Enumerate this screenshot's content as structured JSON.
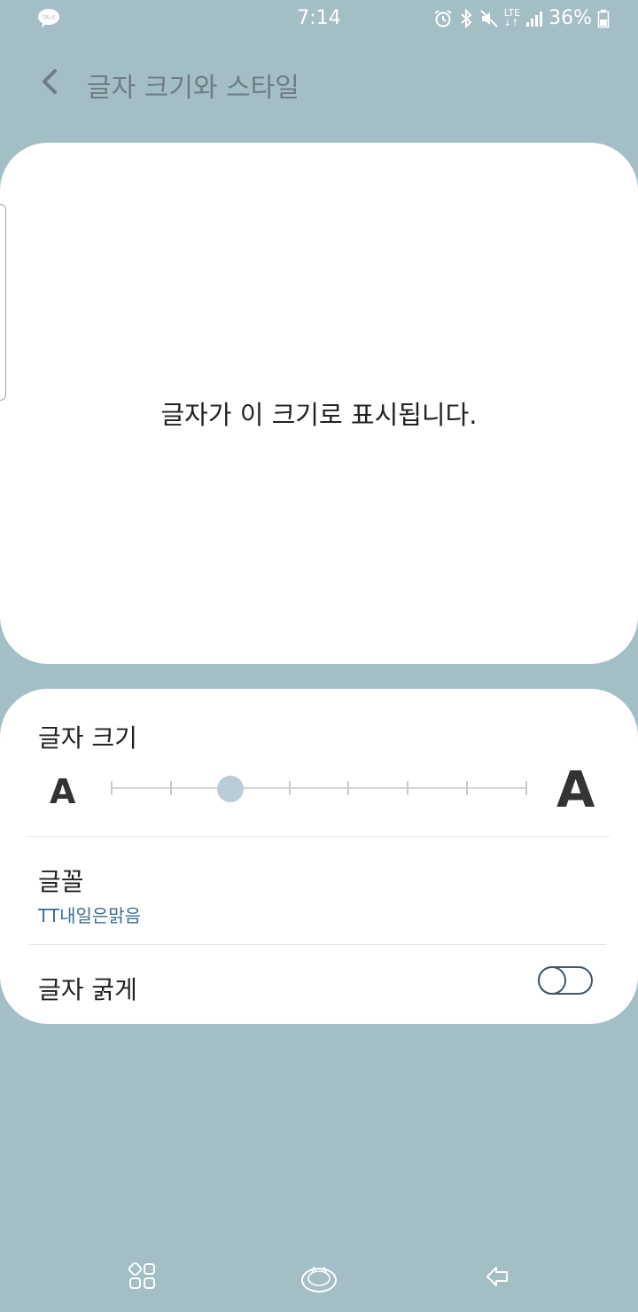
{
  "status_bar": {
    "time": "7:14",
    "talk_badge": "TALK",
    "network": "LTE",
    "battery": "36%",
    "icons": [
      "kakaotalk-icon",
      "alarm-icon",
      "bluetooth-icon",
      "mute-icon",
      "lte-icon",
      "signal-icon",
      "battery-icon"
    ]
  },
  "appbar": {
    "title": "글자 크기와 스타일"
  },
  "preview": {
    "text": "글자가 이 크기로 표시됩니다."
  },
  "font_size": {
    "label": "글자 크기",
    "small_glyph": "A",
    "large_glyph": "A",
    "steps": 8,
    "selected_step": 3
  },
  "font": {
    "label": "글꼴",
    "value": "TT내일은맑음"
  },
  "bold_text": {
    "label": "글자 굵게",
    "enabled": false
  },
  "colors": {
    "background": "#a4bec6",
    "accent_blue": "#3b6e92",
    "thumb": "#b9ccd7"
  },
  "nav": {
    "icons": [
      "recent-apps-icon",
      "home-icon",
      "back-icon"
    ]
  }
}
